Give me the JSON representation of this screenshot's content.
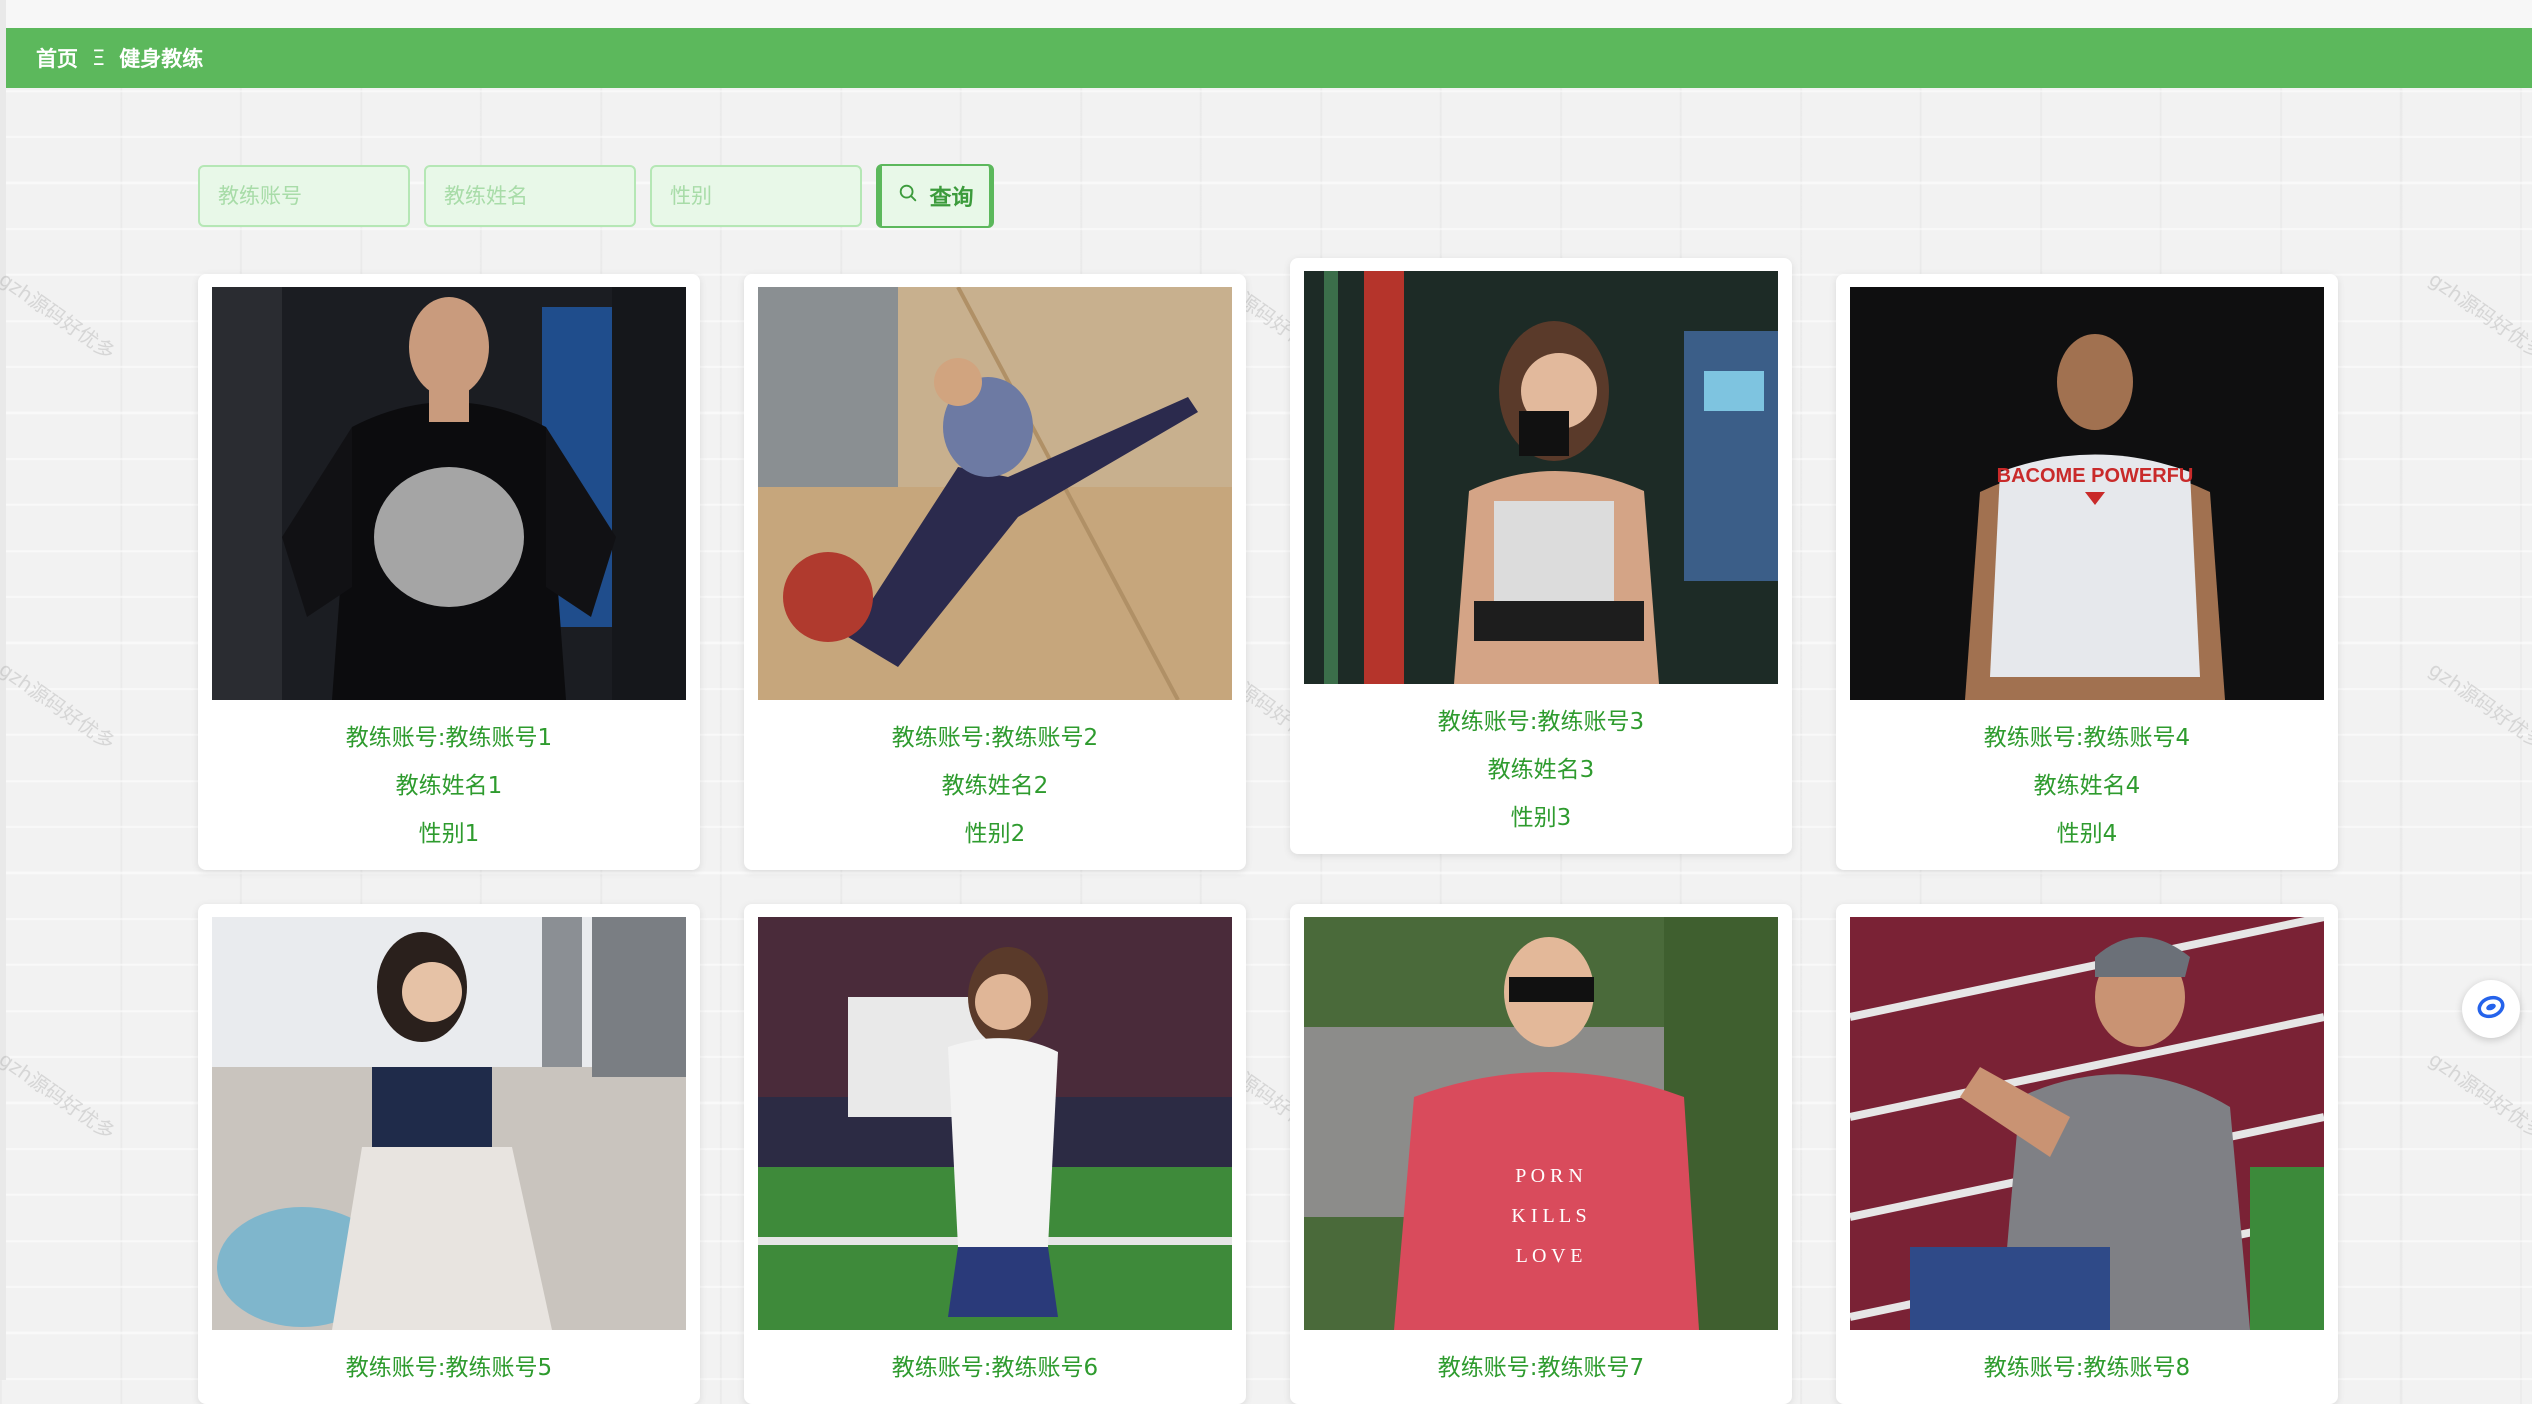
{
  "breadcrumb": {
    "home": "首页",
    "separator": "Ξ",
    "current": "健身教练"
  },
  "search": {
    "account_placeholder": "教练账号",
    "name_placeholder": "教练姓名",
    "gender_placeholder": "性别",
    "query_button": "查询"
  },
  "coaches": [
    {
      "account": "教练账号:教练账号1",
      "name": "教练姓名1",
      "gender": "性别1"
    },
    {
      "account": "教练账号:教练账号2",
      "name": "教练姓名2",
      "gender": "性别2"
    },
    {
      "account": "教练账号:教练账号3",
      "name": "教练姓名3",
      "gender": "性别3"
    },
    {
      "account": "教练账号:教练账号4",
      "name": "教练姓名4",
      "gender": "性别4"
    },
    {
      "account": "教练账号:教练账号5"
    },
    {
      "account": "教练账号:教练账号6"
    },
    {
      "account": "教练账号:教练账号7"
    },
    {
      "account": "教练账号:教练账号8"
    }
  ],
  "photo_text": {
    "shirt4": "BACOME POWERFU",
    "shirt7_line1": "P O R N",
    "shirt7_line2": "K I L L S",
    "shirt7_line3": "L O V E"
  },
  "watermark_text": "gzh源码好优多",
  "colors": {
    "brand_green": "#5cb85c",
    "text_green": "#2e9b2e",
    "input_bg": "#e8f8e8"
  }
}
